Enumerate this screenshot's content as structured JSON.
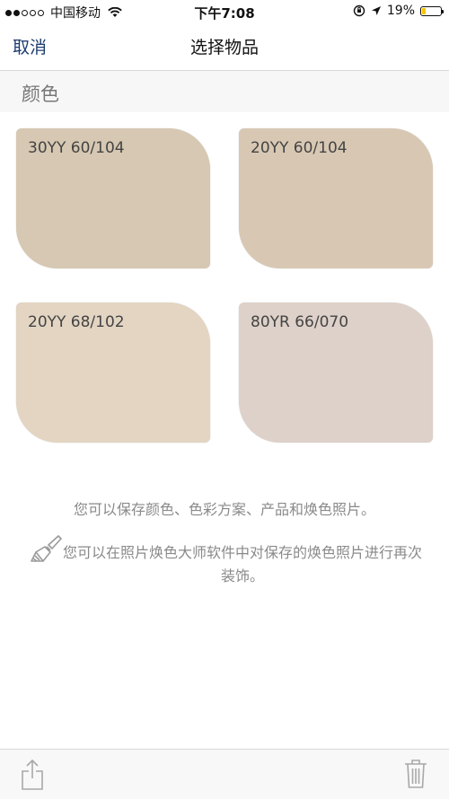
{
  "status_bar": {
    "carrier": "中国移动",
    "time": "下午7:08",
    "battery_percent_text": "19%",
    "battery_level": 0.19,
    "signal_dots_filled": 2,
    "signal_dots_total": 5
  },
  "nav": {
    "cancel_label": "取消",
    "title": "选择物品"
  },
  "section": {
    "title": "颜色"
  },
  "swatches": [
    {
      "label": "30YY 60/104",
      "color": "#d6c8b2"
    },
    {
      "label": "20YY 60/104",
      "color": "#d8c8b3"
    },
    {
      "label": "20YY 68/102",
      "color": "#e3d5c2"
    },
    {
      "label": "80YR 66/070",
      "color": "#ded1c9"
    }
  ],
  "info": {
    "line1": "您可以保存颜色、色彩方案、产品和焕色照片。",
    "line2": "您可以在照片焕色大师软件中对保存的焕色照片进行再次装饰。"
  },
  "toolbar": {
    "share_icon": "share-icon",
    "trash_icon": "trash-icon"
  }
}
